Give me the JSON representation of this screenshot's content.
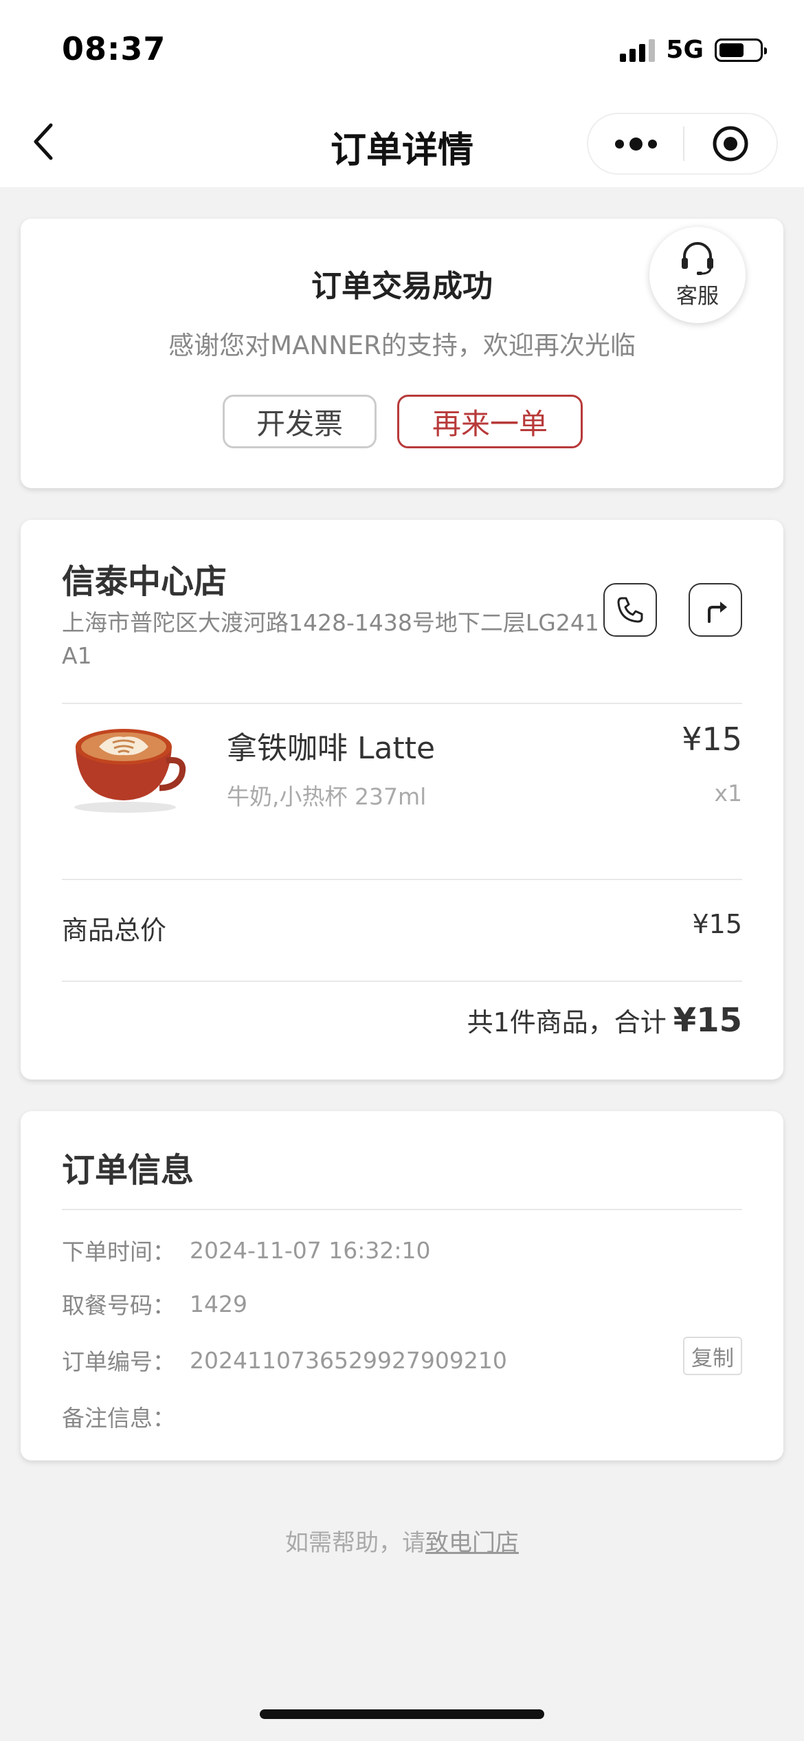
{
  "status_bar": {
    "time": "08:37",
    "network": "5G",
    "battery_level": 0.62
  },
  "header": {
    "title": "订单详情"
  },
  "order_status": {
    "title": "订单交易成功",
    "subtitle": "感谢您对MANNER的支持，欢迎再次光临",
    "invoice_button": "开发票",
    "reorder_button": "再来一单",
    "service_label": "客服"
  },
  "store": {
    "name": "信泰中心店",
    "address": "上海市普陀区大渡河路1428-1438号地下二层LG241A1"
  },
  "items": [
    {
      "name": "拿铁咖啡 Latte",
      "spec": "牛奶,小热杯 237ml",
      "price": "¥15",
      "qty": "x1"
    }
  ],
  "summary": {
    "subtotal_label": "商品总价",
    "subtotal_value": "¥15",
    "total_text": "共1件商品，合计",
    "total_amount": "¥15"
  },
  "order_info": {
    "title": "订单信息",
    "rows": [
      {
        "label": "下单时间：",
        "value": "2024-11-07 16:32:10"
      },
      {
        "label": "取餐号码：",
        "value": "1429"
      },
      {
        "label": "订单编号：",
        "value": "2024110736529927909210"
      },
      {
        "label": "备注信息：",
        "value": ""
      }
    ],
    "copy_button": "复制"
  },
  "footer": {
    "help_prefix": "如需帮助，请",
    "help_link": "致电门店"
  },
  "colors": {
    "accent": "#b83a3a",
    "background": "#f2f2f2"
  }
}
